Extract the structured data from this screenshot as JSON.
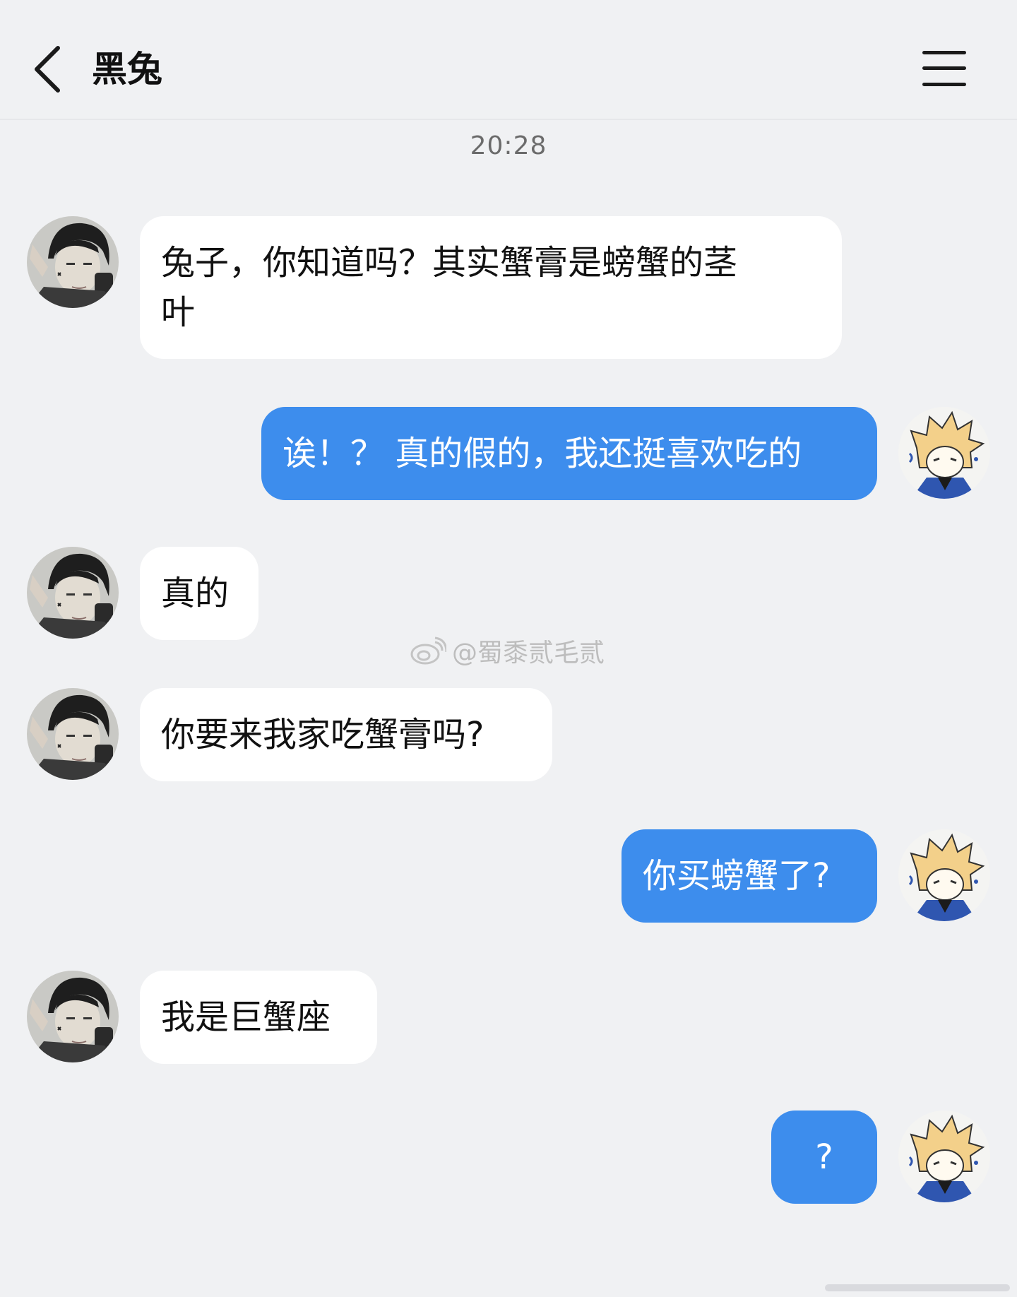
{
  "header": {
    "title": "黑兔",
    "back_icon": "chevron-left-icon",
    "menu_icon": "hamburger-menu-icon"
  },
  "timestamp": "20:28",
  "messages": [
    {
      "side": "in",
      "text_lines": [
        "兔子，你知道吗？其实蟹膏是螃蟹的茎",
        "叶"
      ]
    },
    {
      "side": "out",
      "text": "诶！？ 真的假的，我还挺喜欢吃的"
    },
    {
      "side": "in",
      "text": "真的"
    },
    {
      "side": "in",
      "text": "你要来我家吃蟹膏吗?"
    },
    {
      "side": "out",
      "text": "你买螃蟹了?"
    },
    {
      "side": "in",
      "text": "我是巨蟹座"
    },
    {
      "side": "out",
      "text": "?"
    }
  ],
  "watermark": {
    "icon": "weibo-icon",
    "text": "@蜀黍贰毛贰"
  },
  "colors": {
    "background": "#f0f1f3",
    "incoming_bubble": "#ffffff",
    "outgoing_bubble": "#3d8ded"
  }
}
